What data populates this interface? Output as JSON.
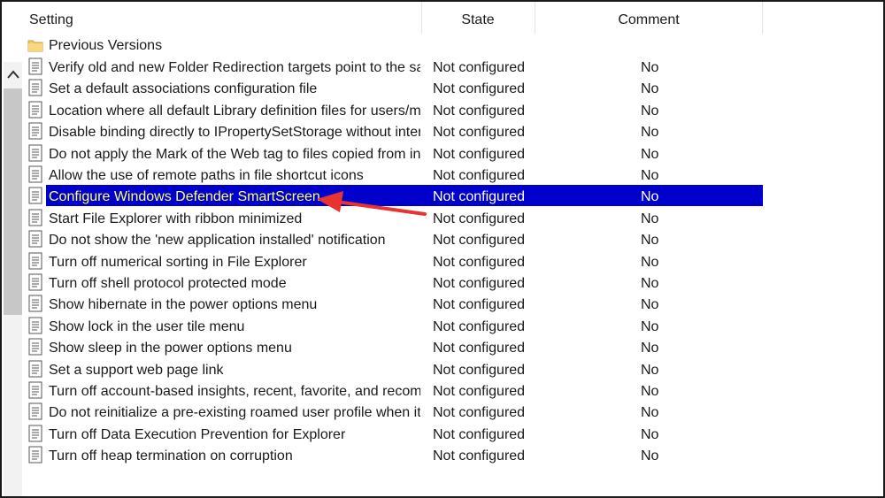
{
  "columns": {
    "setting": "Setting",
    "state": "State",
    "comment": "Comment"
  },
  "folder": {
    "label": "Previous Versions",
    "icon": "folder-icon"
  },
  "rows": [
    {
      "setting": "Verify old and new Folder Redirection targets point to the sa...",
      "state": "Not configured",
      "comment": "No"
    },
    {
      "setting": "Set a default associations configuration file",
      "state": "Not configured",
      "comment": "No"
    },
    {
      "setting": "Location where all default Library definition files for users/ma...",
      "state": "Not configured",
      "comment": "No"
    },
    {
      "setting": "Disable binding directly to IPropertySetStorage without inter...",
      "state": "Not configured",
      "comment": "No"
    },
    {
      "setting": "Do not apply the Mark of the Web tag to files copied from in...",
      "state": "Not configured",
      "comment": "No"
    },
    {
      "setting": "Allow the use of remote paths in file shortcut icons",
      "state": "Not configured",
      "comment": "No"
    },
    {
      "setting": "Configure Windows Defender SmartScreen",
      "state": "Not configured",
      "comment": "No"
    },
    {
      "setting": "Start File Explorer with ribbon minimized",
      "state": "Not configured",
      "comment": "No"
    },
    {
      "setting": "Do not show the 'new application installed' notification",
      "state": "Not configured",
      "comment": "No"
    },
    {
      "setting": "Turn off numerical sorting in File Explorer",
      "state": "Not configured",
      "comment": "No"
    },
    {
      "setting": "Turn off shell protocol protected mode",
      "state": "Not configured",
      "comment": "No"
    },
    {
      "setting": "Show hibernate in the power options menu",
      "state": "Not configured",
      "comment": "No"
    },
    {
      "setting": "Show lock in the user tile menu",
      "state": "Not configured",
      "comment": "No"
    },
    {
      "setting": "Show sleep in the power options menu",
      "state": "Not configured",
      "comment": "No"
    },
    {
      "setting": "Set a support web page link",
      "state": "Not configured",
      "comment": "No"
    },
    {
      "setting": "Turn off account-based insights, recent, favorite, and recomm...",
      "state": "Not configured",
      "comment": "No"
    },
    {
      "setting": "Do not reinitialize a pre-existing roamed user profile when it i...",
      "state": "Not configured",
      "comment": "No"
    },
    {
      "setting": "Turn off Data Execution Prevention for Explorer",
      "state": "Not configured",
      "comment": "No"
    },
    {
      "setting": "Turn off heap termination on corruption",
      "state": "Not configured",
      "comment": "No"
    }
  ],
  "selected_row": 6,
  "icons": {
    "row": "policy-setting-icon",
    "scroll_up": "chevron-up-icon",
    "annotation": "red-arrow-icon"
  },
  "colors": {
    "selection_bg": "#0000cc",
    "selection_text": "#ffff66",
    "arrow": "#e8332f"
  }
}
